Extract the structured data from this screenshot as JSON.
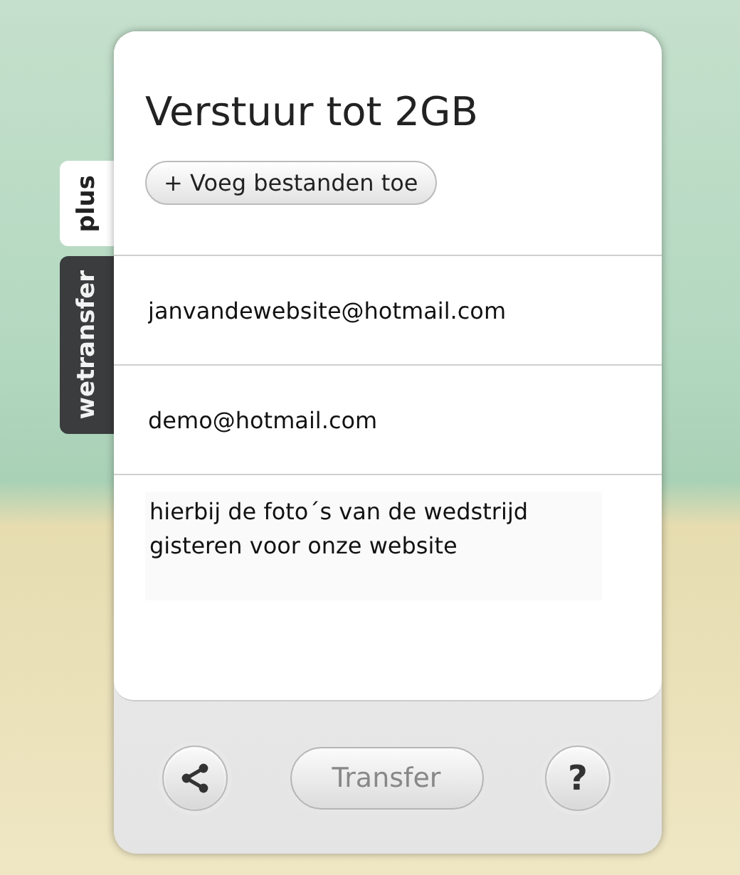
{
  "side_tabs": [
    {
      "label": "plus",
      "selected": true
    },
    {
      "label": "wetransfer",
      "selected": false
    }
  ],
  "panel": {
    "title": "Verstuur tot 2GB",
    "add_files_button": "+ Voeg bestanden toe",
    "fields": [
      {
        "kind": "input",
        "value": "janvandewebsite@hotmail.com"
      },
      {
        "kind": "input",
        "value": "demo@hotmail.com"
      },
      {
        "kind": "message",
        "value": "hierbij de foto´s van de wedstrijd gisteren voor onze website"
      }
    ]
  },
  "footer": {
    "transfer_button": "Transfer",
    "help_button": "?"
  }
}
